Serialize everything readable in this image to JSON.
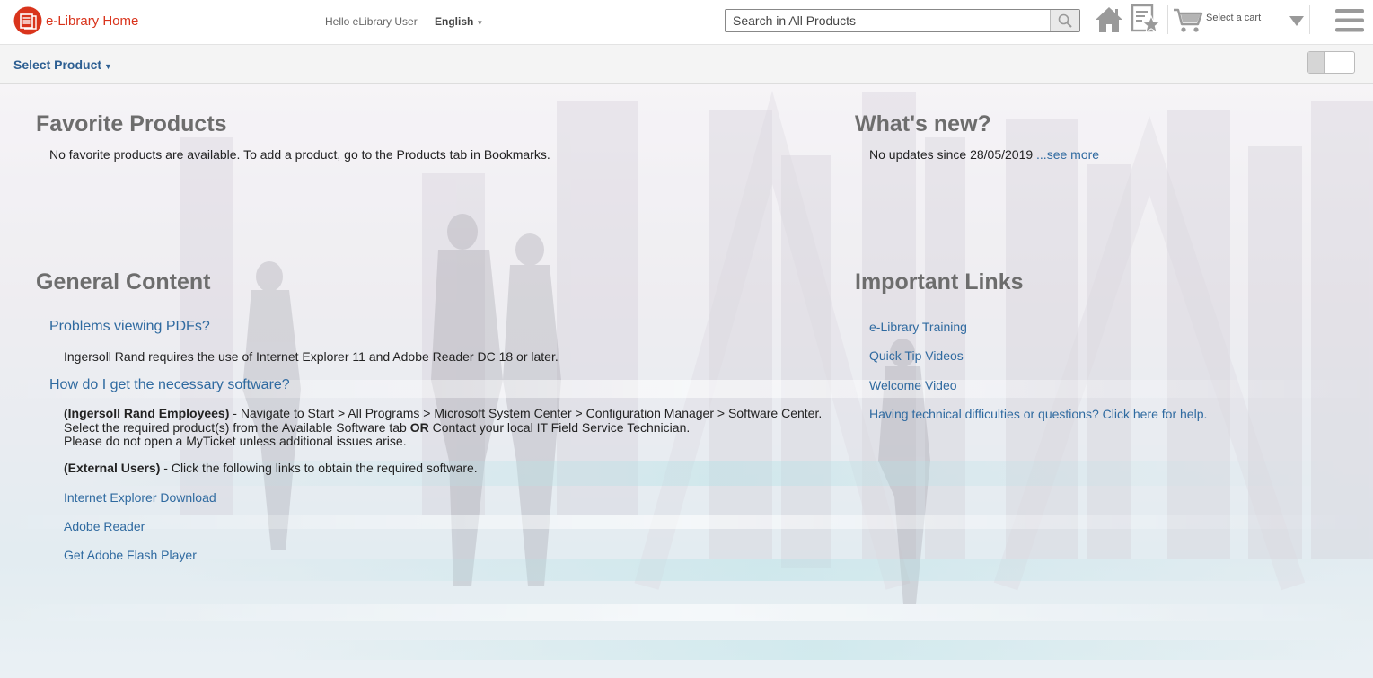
{
  "header": {
    "app_title": "e-Library Home",
    "greeting": "Hello eLibrary User",
    "language": "English",
    "search_placeholder": "Search in All Products",
    "cart_label": "Select a cart",
    "brand_color": "#d9341c",
    "icons": [
      "elibrary-logo-icon",
      "search-icon",
      "home-icon",
      "favorites-icon",
      "cart-icon",
      "chevron-down-icon",
      "menu-icon"
    ]
  },
  "subbar": {
    "select_product": "Select Product"
  },
  "favorites": {
    "title": "Favorite Products",
    "message": "No favorite products are available. To add a product, go to the Products tab in Bookmarks."
  },
  "whats_new": {
    "title": "What's new?",
    "message": "No updates since 28/05/2019",
    "see_more": "...see more"
  },
  "general": {
    "title": "General Content",
    "q1": "Problems viewing PDFs?",
    "a1": "Ingersoll Rand requires the use of Internet Explorer 11 and Adobe Reader DC 18 or later.",
    "q2": "How do I get the necessary software?",
    "employees_label": "(Ingersoll Rand Employees)",
    "employees_line1": " - Navigate to Start > All Programs > Microsoft System Center > Configuration Manager > Software Center.",
    "employees_line2a": "Select the required product(s) from the Available Software tab ",
    "employees_or": "OR",
    "employees_line2b": " Contact your local IT Field Service Technician.",
    "employees_line3": "Please do not open a MyTicket unless additional issues arise.",
    "external_label": "(External Users)",
    "external_text": " - Click the following links to obtain the required software.",
    "links": [
      "Internet Explorer Download",
      "Adobe Reader",
      "Get Adobe Flash Player"
    ]
  },
  "important": {
    "title": "Important Links",
    "links": [
      "e-Library Training",
      "Quick Tip Videos",
      "Welcome Video",
      "Having technical difficulties or questions? Click here for help."
    ]
  },
  "colors": {
    "link": "#2f6aa0",
    "heading": "#6d6d6d",
    "nav_link": "#2d5f92"
  }
}
